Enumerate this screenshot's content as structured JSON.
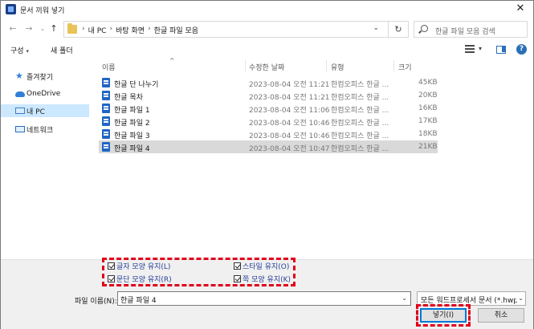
{
  "window": {
    "title": "문서 끼워 넣기"
  },
  "nav": {
    "breadcrumbs": [
      "내 PC",
      "바탕 화면",
      "한글 파일 모음"
    ],
    "search_placeholder": "한글 파일 모음 검색"
  },
  "toolbar": {
    "organize": "구성",
    "new_folder": "새 폴더"
  },
  "sidebar": {
    "items": [
      {
        "label": "즐겨찾기",
        "icon": "star-icon"
      },
      {
        "label": "OneDrive",
        "icon": "cloud-icon"
      },
      {
        "label": "내 PC",
        "icon": "pc-icon",
        "selected": true
      },
      {
        "label": "네트워크",
        "icon": "network-icon"
      }
    ]
  },
  "columns": {
    "name": "이름",
    "date": "수정한 날짜",
    "type": "유형",
    "size": "크기"
  },
  "files": [
    {
      "name": "한글 단 나누기",
      "date": "2023-08-04 오전 11:21",
      "type": "한컴오피스 한글 ...",
      "size": "45KB"
    },
    {
      "name": "한글 목차",
      "date": "2023-08-04 오전 11:21",
      "type": "한컴오피스 한글 ...",
      "size": "20KB"
    },
    {
      "name": "한글 파일 1",
      "date": "2023-08-04 오전 11:06",
      "type": "한컴오피스 한글 ...",
      "size": "16KB"
    },
    {
      "name": "한글 파일 2",
      "date": "2023-08-04 오전 10:46",
      "type": "한컴오피스 한글 ...",
      "size": "17KB"
    },
    {
      "name": "한글 파일 3",
      "date": "2023-08-04 오전 10:46",
      "type": "한컴오피스 한글 ...",
      "size": "18KB"
    },
    {
      "name": "한글 파일 4",
      "date": "2023-08-04 오전 10:47",
      "type": "한컴오피스 한글 ...",
      "size": "21KB",
      "selected": true
    }
  ],
  "options": {
    "keep_char_shape": "글자 모양 유지(L)",
    "keep_style": "스타일 유지(O)",
    "keep_para_shape": "문단 모양 유지(R)",
    "keep_page_shape": "쪽 모양 유지(K)"
  },
  "footer": {
    "filename_label": "파일 이름(N):",
    "filename_value": "한글 파일 4",
    "filetype_value": "모든 워드프로세서 문서 (*.hwp",
    "open_label": "넣기(I)",
    "cancel_label": "취소"
  },
  "colors": {
    "accent": "#0078d7",
    "highlight": "#e0001b",
    "selected_nav": "#cce8ff"
  }
}
